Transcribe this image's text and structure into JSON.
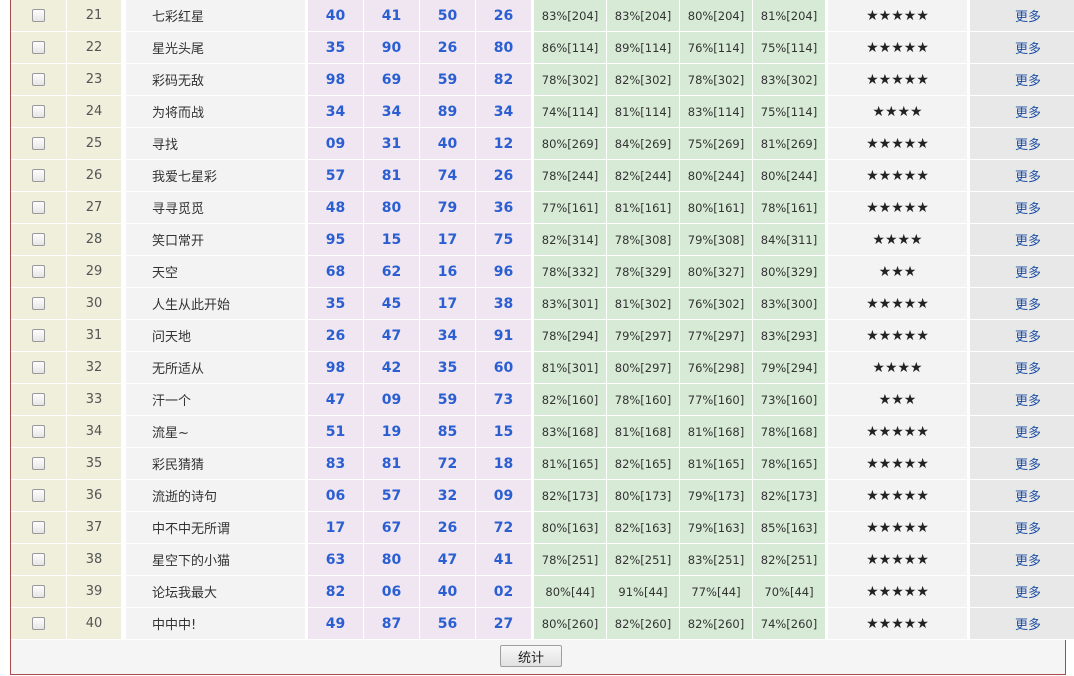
{
  "table": {
    "more_label": "更多",
    "rows": [
      {
        "idx": "21",
        "name": "七彩红星",
        "nums": [
          "40",
          "41",
          "50",
          "26"
        ],
        "pcts": [
          "83%[204]",
          "83%[204]",
          "80%[204]",
          "81%[204]"
        ],
        "stars": "★★★★★"
      },
      {
        "idx": "22",
        "name": "星光头尾",
        "nums": [
          "35",
          "90",
          "26",
          "80"
        ],
        "pcts": [
          "86%[114]",
          "89%[114]",
          "76%[114]",
          "75%[114]"
        ],
        "stars": "★★★★★"
      },
      {
        "idx": "23",
        "name": "彩码无敌",
        "nums": [
          "98",
          "69",
          "59",
          "82"
        ],
        "pcts": [
          "78%[302]",
          "82%[302]",
          "78%[302]",
          "83%[302]"
        ],
        "stars": "★★★★★"
      },
      {
        "idx": "24",
        "name": "为将而战",
        "nums": [
          "34",
          "34",
          "89",
          "34"
        ],
        "pcts": [
          "74%[114]",
          "81%[114]",
          "83%[114]",
          "75%[114]"
        ],
        "stars": "★★★★"
      },
      {
        "idx": "25",
        "name": "寻找",
        "nums": [
          "09",
          "31",
          "40",
          "12"
        ],
        "pcts": [
          "80%[269]",
          "84%[269]",
          "75%[269]",
          "81%[269]"
        ],
        "stars": "★★★★★"
      },
      {
        "idx": "26",
        "name": "我爱七星彩",
        "nums": [
          "57",
          "81",
          "74",
          "26"
        ],
        "pcts": [
          "78%[244]",
          "82%[244]",
          "80%[244]",
          "80%[244]"
        ],
        "stars": "★★★★★"
      },
      {
        "idx": "27",
        "name": "寻寻觅觅",
        "nums": [
          "48",
          "80",
          "79",
          "36"
        ],
        "pcts": [
          "77%[161]",
          "81%[161]",
          "80%[161]",
          "78%[161]"
        ],
        "stars": "★★★★★"
      },
      {
        "idx": "28",
        "name": "笑口常开",
        "nums": [
          "95",
          "15",
          "17",
          "75"
        ],
        "pcts": [
          "82%[314]",
          "78%[308]",
          "79%[308]",
          "84%[311]"
        ],
        "stars": "★★★★"
      },
      {
        "idx": "29",
        "name": "天空",
        "nums": [
          "68",
          "62",
          "16",
          "96"
        ],
        "pcts": [
          "78%[332]",
          "78%[329]",
          "80%[327]",
          "80%[329]"
        ],
        "stars": "★★★"
      },
      {
        "idx": "30",
        "name": "人生从此开始",
        "nums": [
          "35",
          "45",
          "17",
          "38"
        ],
        "pcts": [
          "83%[301]",
          "81%[302]",
          "76%[302]",
          "83%[300]"
        ],
        "stars": "★★★★★"
      },
      {
        "idx": "31",
        "name": "问天地",
        "nums": [
          "26",
          "47",
          "34",
          "91"
        ],
        "pcts": [
          "78%[294]",
          "79%[297]",
          "77%[297]",
          "83%[293]"
        ],
        "stars": "★★★★★"
      },
      {
        "idx": "32",
        "name": "无所适从",
        "nums": [
          "98",
          "42",
          "35",
          "60"
        ],
        "pcts": [
          "81%[301]",
          "80%[297]",
          "76%[298]",
          "79%[294]"
        ],
        "stars": "★★★★"
      },
      {
        "idx": "33",
        "name": "汗一个",
        "nums": [
          "47",
          "09",
          "59",
          "73"
        ],
        "pcts": [
          "82%[160]",
          "78%[160]",
          "77%[160]",
          "73%[160]"
        ],
        "stars": "★★★"
      },
      {
        "idx": "34",
        "name": "流星~",
        "nums": [
          "51",
          "19",
          "85",
          "15"
        ],
        "pcts": [
          "83%[168]",
          "81%[168]",
          "81%[168]",
          "78%[168]"
        ],
        "stars": "★★★★★"
      },
      {
        "idx": "35",
        "name": "彩民猜猜",
        "nums": [
          "83",
          "81",
          "72",
          "18"
        ],
        "pcts": [
          "81%[165]",
          "82%[165]",
          "81%[165]",
          "78%[165]"
        ],
        "stars": "★★★★★"
      },
      {
        "idx": "36",
        "name": "流逝的诗句",
        "nums": [
          "06",
          "57",
          "32",
          "09"
        ],
        "pcts": [
          "82%[173]",
          "80%[173]",
          "79%[173]",
          "82%[173]"
        ],
        "stars": "★★★★★"
      },
      {
        "idx": "37",
        "name": "中不中无所谓",
        "nums": [
          "17",
          "67",
          "26",
          "72"
        ],
        "pcts": [
          "80%[163]",
          "82%[163]",
          "79%[163]",
          "85%[163]"
        ],
        "stars": "★★★★★"
      },
      {
        "idx": "38",
        "name": "星空下的小猫",
        "nums": [
          "63",
          "80",
          "47",
          "41"
        ],
        "pcts": [
          "78%[251]",
          "82%[251]",
          "83%[251]",
          "82%[251]"
        ],
        "stars": "★★★★★"
      },
      {
        "idx": "39",
        "name": "论坛我最大",
        "nums": [
          "82",
          "06",
          "40",
          "02"
        ],
        "pcts": [
          "80%[44]",
          "91%[44]",
          "77%[44]",
          "70%[44]"
        ],
        "stars": "★★★★★"
      },
      {
        "idx": "40",
        "name": "中中中!",
        "nums": [
          "49",
          "87",
          "56",
          "27"
        ],
        "pcts": [
          "80%[260]",
          "82%[260]",
          "82%[260]",
          "74%[260]"
        ],
        "stars": "★★★★★"
      }
    ]
  },
  "footer": {
    "stat_button_label": "统计"
  },
  "colors": {
    "number_blue": "#2b5fd1",
    "link_blue": "#1f4fa3",
    "border_red": "#a84b4b"
  }
}
